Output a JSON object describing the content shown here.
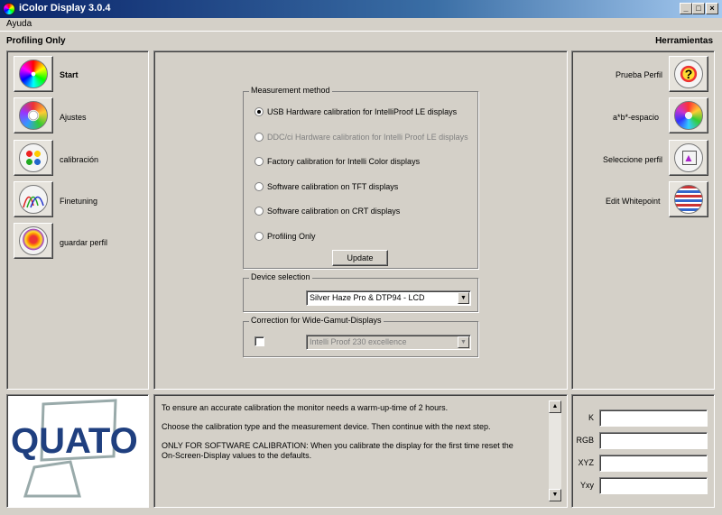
{
  "window": {
    "title": "iColor Display 3.0.4",
    "controls": [
      "_",
      "□",
      "×"
    ]
  },
  "menu": {
    "items": [
      "Ayuda"
    ]
  },
  "left": {
    "section_title": "Profiling Only",
    "items": [
      {
        "label": "Start",
        "icon": "color-wheel-icon",
        "bold": true
      },
      {
        "label": "Ajustes",
        "icon": "settings-icon",
        "bold": false
      },
      {
        "label": "calibración",
        "icon": "color-grid-icon",
        "bold": false
      },
      {
        "label": "Finetuning",
        "icon": "curves-icon",
        "bold": false
      },
      {
        "label": "guardar perfil",
        "icon": "save-profile-icon",
        "bold": false
      }
    ]
  },
  "right": {
    "section_title": "Herramientas",
    "items": [
      {
        "label": "Prueba Perfil",
        "icon": "profile-test-icon"
      },
      {
        "label": "a*b*-espacio",
        "icon": "lab-space-icon"
      },
      {
        "label": "Seleccione perfil",
        "icon": "select-profile-icon"
      },
      {
        "label": "Edit Whitepoint",
        "icon": "whitepoint-icon"
      }
    ]
  },
  "measurement": {
    "legend": "Measurement method",
    "options": [
      {
        "label": "USB Hardware calibration for IntelliProof LE displays",
        "checked": true,
        "disabled": false
      },
      {
        "label": "DDC/ci Hardware calibration for Intelli Proof LE displays",
        "checked": false,
        "disabled": true
      },
      {
        "label": "Factory calibration for Intelli Color displays",
        "checked": false,
        "disabled": false
      },
      {
        "label": "Software calibration on TFT displays",
        "checked": false,
        "disabled": false
      },
      {
        "label": "Software calibration on CRT displays",
        "checked": false,
        "disabled": false
      },
      {
        "label": "Profiling Only",
        "checked": false,
        "disabled": false
      }
    ],
    "update_label": "Update"
  },
  "device": {
    "legend": "Device selection",
    "selected": "Silver Haze Pro & DTP94 - LCD"
  },
  "widegamut": {
    "legend": "Correction for Wide-Gamut-Displays",
    "checked": false,
    "selected": "Intelli Proof 230 excellence"
  },
  "info": {
    "logo_text": "QUATO",
    "lines": [
      "To ensure an accurate calibration the monitor needs a warm-up-time of 2 hours.",
      "Choose the calibration type and the measurement device. Then continue with the next step.",
      "ONLY FOR SOFTWARE CALIBRATION: When you calibrate the display for the first time reset the On-Screen-Display values to the defaults."
    ]
  },
  "readouts": [
    {
      "label": "K",
      "value": ""
    },
    {
      "label": "RGB",
      "value": ""
    },
    {
      "label": "XYZ",
      "value": ""
    },
    {
      "label": "Yxy",
      "value": ""
    }
  ],
  "colors": {
    "title_bar": "#0a246a",
    "window_bg": "#d4d0c8",
    "logo_blue": "#1f3f7f"
  }
}
